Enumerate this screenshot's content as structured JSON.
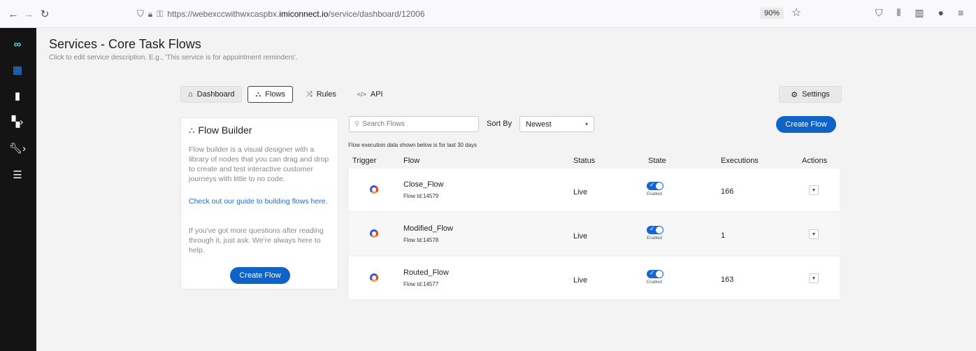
{
  "browser": {
    "url_prefix": "https://webexccwithwxcaspbx.",
    "url_host": "imiconnect.io",
    "url_path": "/service/dashboard/12006",
    "zoom": "90%"
  },
  "page": {
    "title": "Services - Core Task Flows",
    "subtitle": "Click to edit service description. E.g., 'This service is for appointment reminders'."
  },
  "tabs": [
    {
      "label": "Dashboard"
    },
    {
      "label": "Flows"
    },
    {
      "label": "Rules"
    },
    {
      "label": "API"
    }
  ],
  "settings_label": "Settings",
  "flow_builder": {
    "title": "Flow Builder",
    "description": "Flow builder is a visual designer with a library of nodes that you can drag and drop to create and test interactive customer journeys with little to no code.",
    "guide_link": "Check out our guide to building flows here.",
    "more_help": "If you've got more questions after reading through it, just ask. We're always here to help.",
    "create_label": "Create Flow"
  },
  "search": {
    "placeholder": "Search Flows"
  },
  "sort": {
    "label": "Sort By",
    "value": "Newest"
  },
  "create_flow_label": "Create Flow",
  "execution_note": "Flow execution data shown below is for last 30 days",
  "table": {
    "headers": {
      "trigger": "Trigger",
      "flow": "Flow",
      "status": "Status",
      "state": "State",
      "executions": "Executions",
      "actions": "Actions"
    },
    "rows": [
      {
        "name": "Close_Flow",
        "flow_id": "Flow Id:14579",
        "status": "Live",
        "state": "Enabled",
        "executions": "166"
      },
      {
        "name": "Modified_Flow",
        "flow_id": "Flow Id:14578",
        "status": "Live",
        "state": "Enabled",
        "executions": "1"
      },
      {
        "name": "Routed_Flow",
        "flow_id": "Flow Id:14577",
        "status": "Live",
        "state": "Enabled",
        "executions": "163"
      }
    ]
  },
  "colors": {
    "primary": "#0f62c6",
    "link": "#1a6fd1",
    "sidebar": "#141414"
  }
}
